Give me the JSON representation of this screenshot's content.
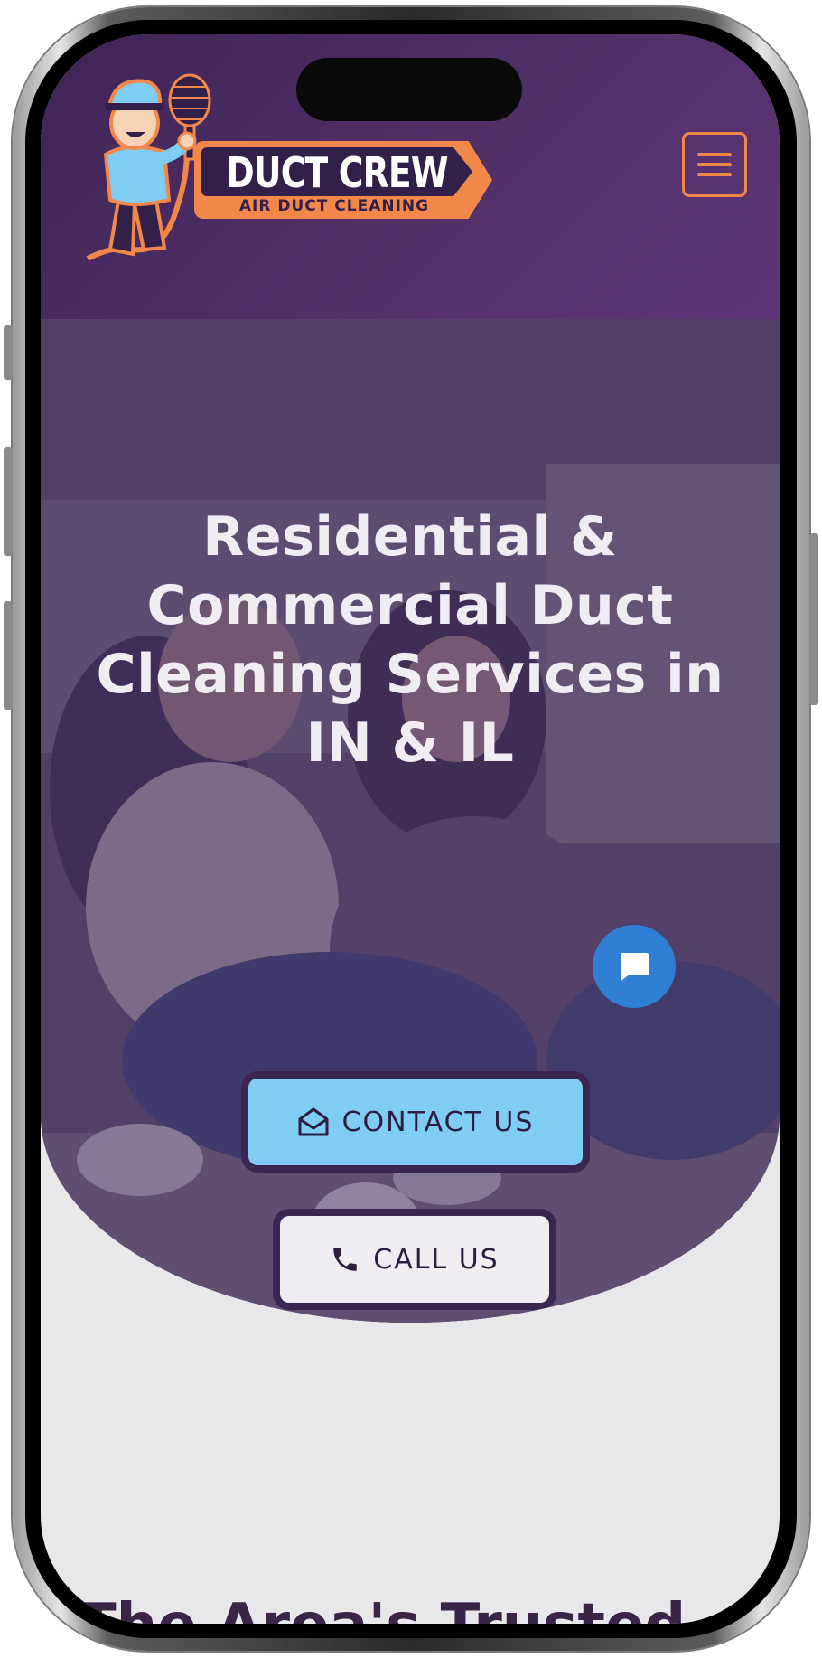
{
  "brand": {
    "name": "DUCT CREW",
    "tagline": "AIR DUCT CLEANING",
    "colors": {
      "purple": "#513068",
      "orange": "#f2874a",
      "light_blue": "#7fcdf2",
      "chat_blue": "#2f7fd4"
    }
  },
  "header": {
    "menu_icon": "hamburger-menu-icon"
  },
  "hero": {
    "title": "Residential & Commercial Duct Cleaning Services in IN & IL",
    "contact_button": {
      "icon": "envelope-open-icon",
      "label": "CONTACT US"
    },
    "call_button": {
      "icon": "phone-icon",
      "label": "CALL US"
    },
    "chat_icon": "chat-bubble-icon"
  },
  "next_section": {
    "heading": "The Area's Trusted"
  }
}
